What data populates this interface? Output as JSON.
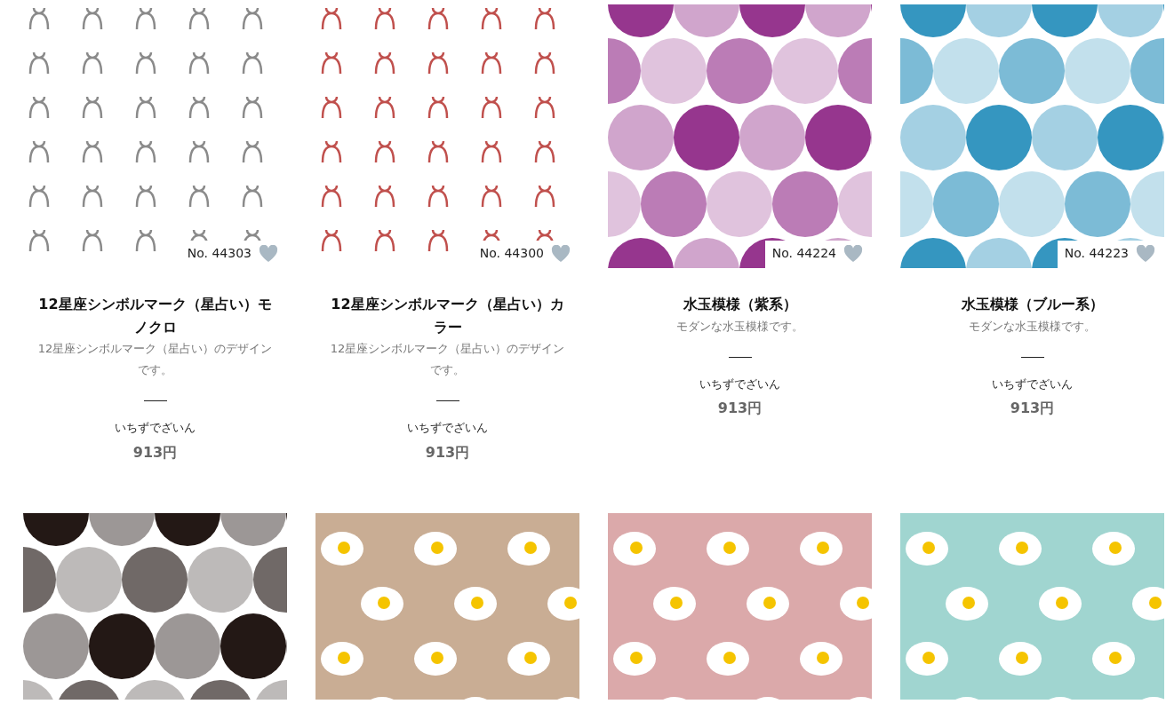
{
  "products": [
    {
      "image": {
        "kind": "zodiac",
        "color": "#8a8a8a"
      },
      "number": "No. 44303",
      "favorited": false,
      "title": "12星座シンボルマーク（星占い）モノクロ",
      "description": "12星座シンボルマーク（星占い）のデザインです。",
      "maker": "いちずでざいん",
      "price": "913円"
    },
    {
      "image": {
        "kind": "zodiac",
        "color": "#c0504d"
      },
      "number": "No. 44300",
      "favorited": false,
      "title": "12星座シンボルマーク（星占い）カラー",
      "description": "12星座シンボルマーク（星占い）のデザインです。",
      "maker": "いちずでざいん",
      "price": "913円"
    },
    {
      "image": {
        "kind": "dots",
        "color": "#96368e"
      },
      "number": "No. 44224",
      "favorited": false,
      "title": "水玉模様（紫系）",
      "description": "モダンな水玉模様です。",
      "maker": "いちずでざいん",
      "price": "913円"
    },
    {
      "image": {
        "kind": "dots",
        "color": "#3596c0"
      },
      "number": "No. 44223",
      "favorited": false,
      "title": "水玉模様（ブルー系）",
      "description": "モダンな水玉模様です。",
      "maker": "いちずでざいん",
      "price": "913円"
    },
    {
      "image": {
        "kind": "dots",
        "color": "#231815"
      }
    },
    {
      "image": {
        "kind": "eggs",
        "color": "#c9ad94"
      }
    },
    {
      "image": {
        "kind": "eggs",
        "color": "#dba9aa"
      }
    },
    {
      "image": {
        "kind": "eggs",
        "color": "#a0d5d0"
      }
    }
  ]
}
